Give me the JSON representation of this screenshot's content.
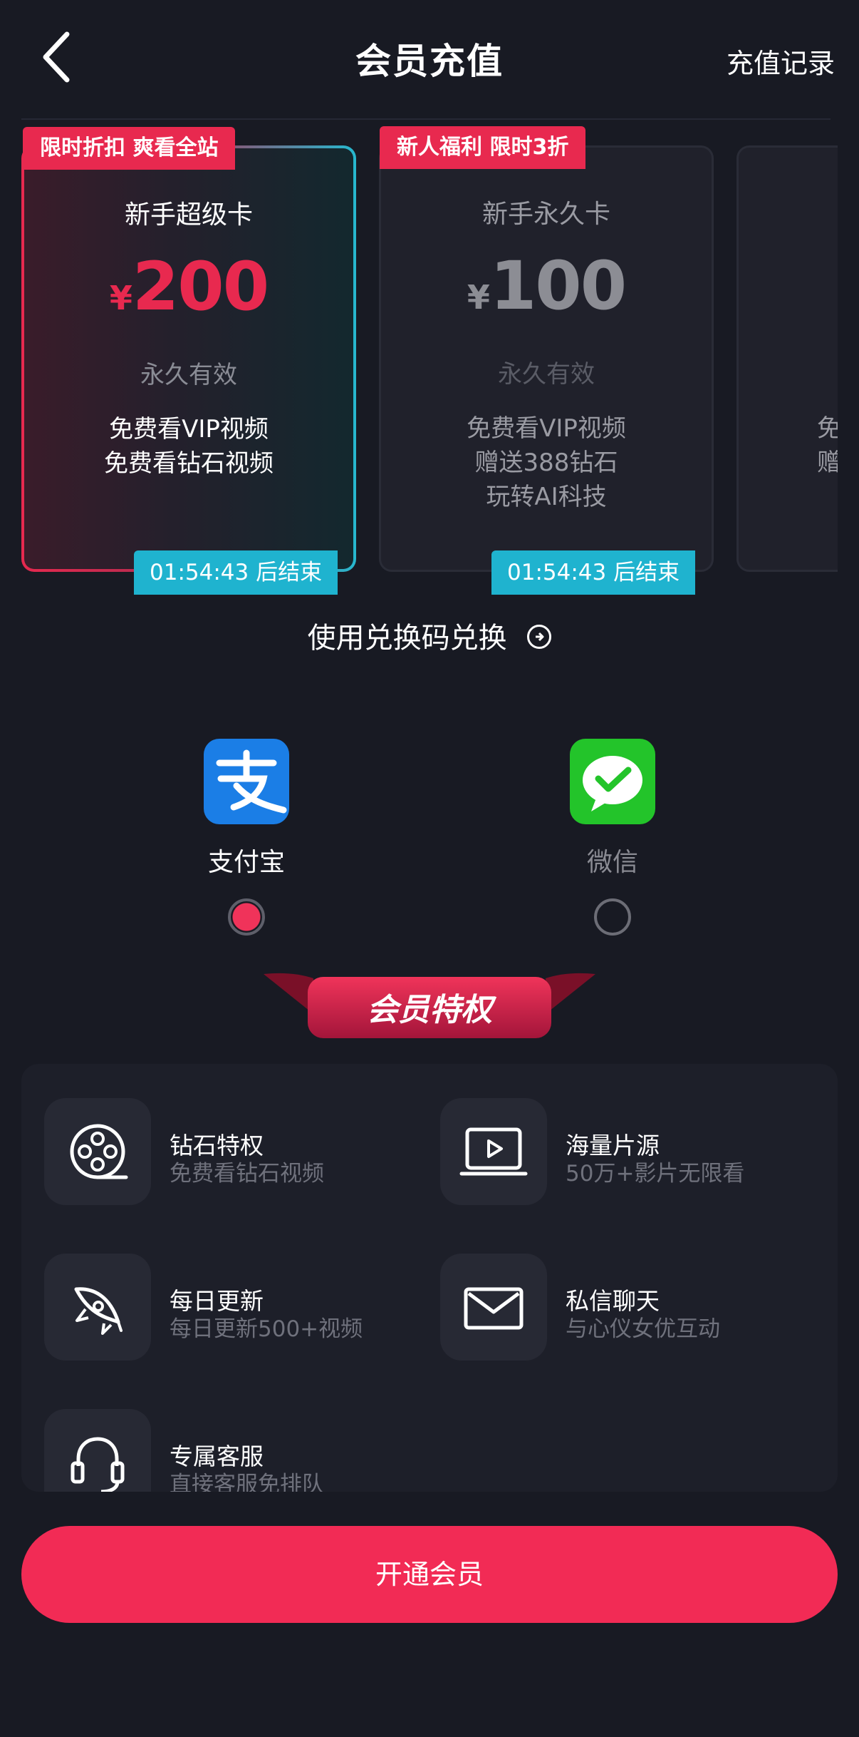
{
  "header": {
    "title": "会员充值",
    "history_link": "充值记录"
  },
  "plans": [
    {
      "badge": "限时折扣 爽看全站",
      "name": "新手超级卡",
      "currency": "¥",
      "price": "200",
      "validity": "永久有效",
      "features": [
        "免费看VIP视频",
        "免费看钻石视频"
      ],
      "timer": "01:54:43 后结束",
      "selected": true
    },
    {
      "badge": "新人福利 限时3折",
      "name": "新手永久卡",
      "currency": "¥",
      "price": "100",
      "validity": "永久有效",
      "features": [
        "免费看VIP视频",
        "赠送388钻石",
        "玩转AI科技"
      ],
      "timer": "01:54:43 后结束",
      "selected": false
    },
    {
      "features": [
        "免",
        "赠"
      ],
      "selected": false
    }
  ],
  "redeem": {
    "label": "使用兑换码兑换"
  },
  "payment": [
    {
      "label": "支付宝",
      "icon": "alipay-icon",
      "selected": true,
      "color": "#1b7ee6"
    },
    {
      "label": "微信",
      "icon": "wechat-pay-icon",
      "selected": false,
      "color": "#23c42a"
    }
  ],
  "privileges_title": "会员特权",
  "privileges": [
    {
      "title": "钻石特权",
      "subtitle": "免费看钻石视频",
      "icon": "film-reel-icon"
    },
    {
      "title": "海量片源",
      "subtitle": "50万+影片无限看",
      "icon": "video-screen-icon"
    },
    {
      "title": "每日更新",
      "subtitle": "每日更新500+视频",
      "icon": "rocket-icon"
    },
    {
      "title": "私信聊天",
      "subtitle": "与心仪女优互动",
      "icon": "envelope-icon"
    },
    {
      "title": "专属客服",
      "subtitle": "直接客服免排队",
      "icon": "headset-icon"
    }
  ],
  "cta": {
    "label": "开通会员"
  },
  "colors": {
    "accent": "#f22b55",
    "timer": "#1fb3cf",
    "background": "#181a23"
  }
}
